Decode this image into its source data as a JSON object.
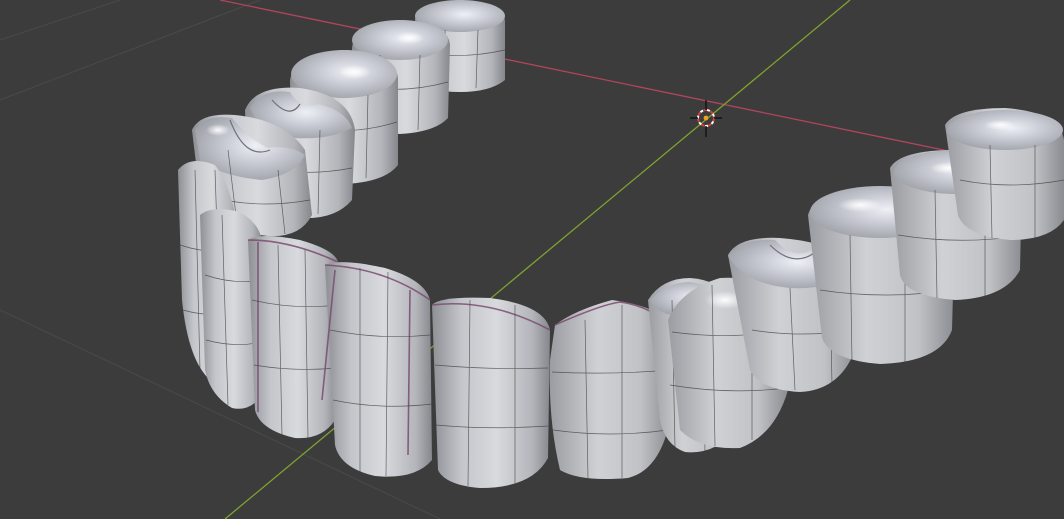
{
  "viewport": {
    "name": "3D Viewport",
    "background_color": "#3c3c3c",
    "grid_color": "#484848",
    "x_axis_color": "#b0455c",
    "y_axis_color": "#7ea32e"
  },
  "scene": {
    "object": "teeth-arch-mesh",
    "material_color": "#c9cbd0",
    "selected_edge_color": "#8a4e7e",
    "cursor": "3d-cursor"
  }
}
